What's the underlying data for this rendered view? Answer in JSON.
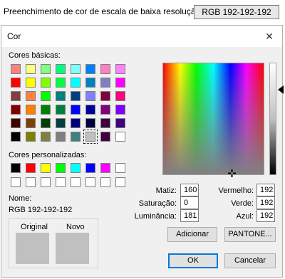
{
  "property_row": {
    "label": "Preenchimento de cor de escala de baixa resolução",
    "value": "RGB 192-192-192"
  },
  "dialog": {
    "title": "Cor",
    "close_glyph": "✕",
    "basic_colors_label": "Cores básicas:",
    "custom_colors_label": "Cores personalizadas:",
    "basic_colors": [
      [
        "#ff8080",
        "#ffff80",
        "#80ff80",
        "#00ff80",
        "#80ffff",
        "#0080ff",
        "#ff80c0",
        "#ff80ff"
      ],
      [
        "#ff0000",
        "#ffff00",
        "#80ff00",
        "#00ff40",
        "#00ffff",
        "#0080c0",
        "#8080c0",
        "#ff00ff"
      ],
      [
        "#804040",
        "#ff8040",
        "#00ff00",
        "#008080",
        "#004080",
        "#8080ff",
        "#800040",
        "#ff0080"
      ],
      [
        "#800000",
        "#ff8000",
        "#008000",
        "#008040",
        "#0000ff",
        "#0000a0",
        "#800080",
        "#8000ff"
      ],
      [
        "#400000",
        "#804000",
        "#004000",
        "#004040",
        "#000080",
        "#000040",
        "#400040",
        "#400080"
      ],
      [
        "#000000",
        "#808000",
        "#808040",
        "#808080",
        "#408080",
        "#c0c0c0",
        "#400040",
        "#ffffff"
      ]
    ],
    "selected_basic": "5-5",
    "custom_colors": [
      [
        "#000000",
        "#ff0000",
        "#ffff00",
        "#00ff00",
        "#00ffff",
        "#0000ff",
        "#ff00ff",
        "#ffffff"
      ],
      [
        "#ffffff",
        "#ffffff",
        "#ffffff",
        "#ffffff",
        "#ffffff",
        "#ffffff",
        "#ffffff",
        "#ffffff"
      ]
    ],
    "name_label": "Nome:",
    "name_value": "RGB 192-192-192",
    "original_label": "Original",
    "new_label": "Novo",
    "original_color": "#c0c0c0",
    "new_color": "#c0c0c0",
    "hue_label": "Matiz:",
    "hue_value": "160",
    "sat_label": "Saturação:",
    "sat_value": "0",
    "lum_label": "Luminância:",
    "lum_value": "181",
    "red_label": "Vermelho:",
    "red_value": "192",
    "green_label": "Verde:",
    "green_value": "192",
    "blue_label": "Azul:",
    "blue_value": "192",
    "add_button": "Adicionar",
    "pantone_button": "PANTONE...",
    "ok_button": "OK",
    "cancel_button": "Cancelar"
  }
}
